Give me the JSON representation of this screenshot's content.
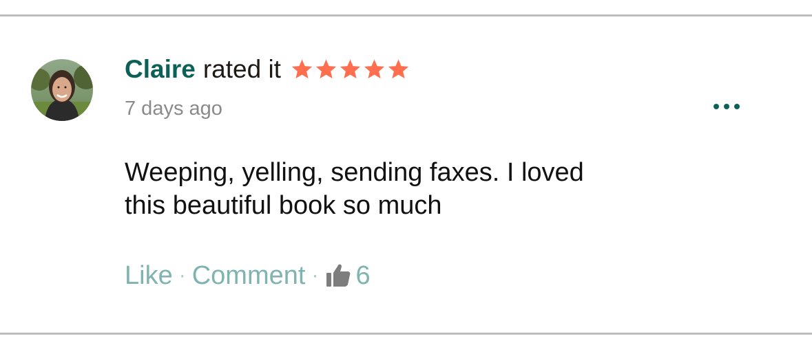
{
  "review": {
    "user_name": "Claire",
    "action_text": "rated it",
    "rating": 5,
    "rating_max": 5,
    "star_color": "#ff6f4f",
    "timestamp": "7 days ago",
    "body": "Weeping, yelling, sending faxes. I loved this beautiful book so much",
    "more_icon": "more-horizontal-icon",
    "avatar_icon": "user-avatar-photo"
  },
  "actions": {
    "like_label": "Like",
    "separator": "·",
    "comment_label": "Comment",
    "like_icon": "thumbs-up-icon",
    "like_count": "6"
  },
  "colors": {
    "accent": "#0b6157",
    "muted_link": "#7fb3b0",
    "text": "#111111",
    "timestamp": "#8a8a8a",
    "divider": "#bdbdbd"
  }
}
